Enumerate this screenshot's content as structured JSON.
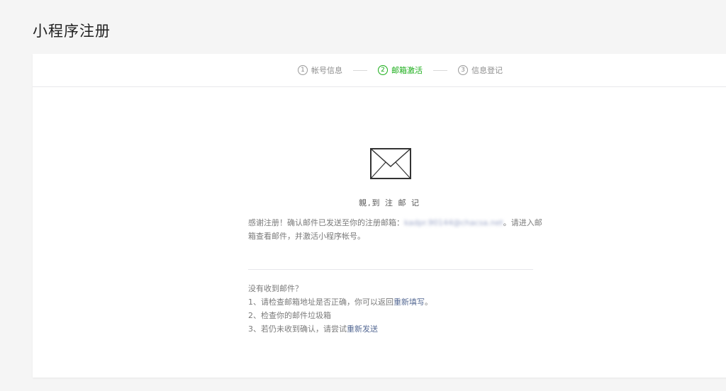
{
  "page": {
    "title": "小程序注册"
  },
  "steps": [
    {
      "num": "1",
      "label": "帐号信息",
      "active": false
    },
    {
      "num": "2",
      "label": "邮箱激活",
      "active": true
    },
    {
      "num": "3",
      "label": "信息登记",
      "active": false
    }
  ],
  "colors": {
    "active": "#1aad19",
    "link": "#576b95"
  },
  "main": {
    "icon": "envelope-icon",
    "greeting": "親,到 注 邮 记",
    "message_prefix": "感谢注册！确认邮件已发送至你的注册邮箱：",
    "email": "kadpr.90144@chacsa.net",
    "message_suffix": "。请进入邮箱查看邮件，并激活小程序帐号。"
  },
  "help": {
    "title": "没有收到邮件？",
    "line1_prefix": "1、请检查邮箱地址是否正确，你可以返回",
    "line1_link": "重新填写",
    "line1_suffix": "。",
    "line2": "2、检查你的邮件垃圾箱",
    "line3_prefix": "3、若仍未收到确认，请尝试",
    "line3_link": "重新发送"
  }
}
